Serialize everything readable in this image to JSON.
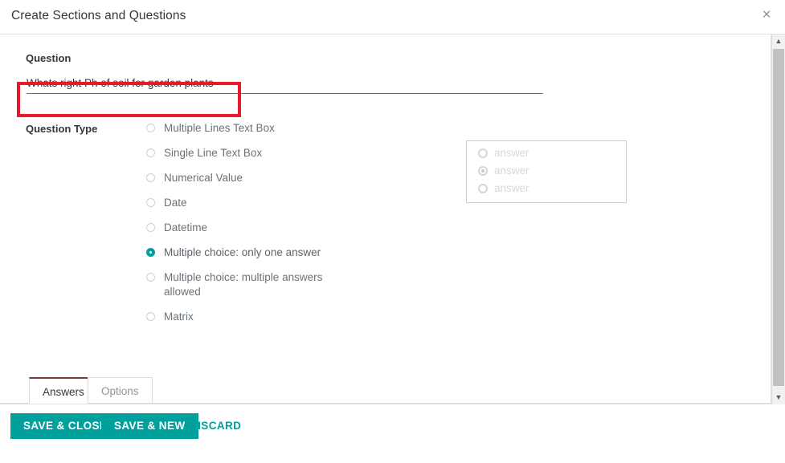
{
  "header": {
    "title": "Create Sections and Questions",
    "close_label": "×"
  },
  "form": {
    "question": {
      "label": "Question",
      "value": "Whats right Ph of soil for garden plants",
      "placeholder": ""
    },
    "question_type": {
      "label": "Question Type",
      "selected": "Multiple choice: only one answer",
      "options": [
        {
          "label": "Multiple Lines Text Box",
          "checked": false
        },
        {
          "label": "Single Line Text Box",
          "checked": false
        },
        {
          "label": "Numerical Value",
          "checked": false
        },
        {
          "label": "Date",
          "checked": false
        },
        {
          "label": "Datetime",
          "checked": false
        },
        {
          "label": "Multiple choice: only one answer",
          "checked": true
        },
        {
          "label": "Multiple choice: multiple answers allowed",
          "checked": false
        },
        {
          "label": "Matrix",
          "checked": false
        }
      ]
    },
    "preview": {
      "rows": [
        {
          "label": "answer",
          "checked": false
        },
        {
          "label": "answer",
          "checked": true
        },
        {
          "label": "answer",
          "checked": false
        }
      ]
    }
  },
  "tabs": [
    {
      "label": "Answers",
      "active": true
    },
    {
      "label": "Options",
      "active": false
    }
  ],
  "footer": {
    "save_close_label": "SAVE & CLOSE",
    "save_new_label": "SAVE & NEW",
    "discard_label": "DISCARD"
  },
  "scrollbar": {
    "up_arrow": "▲",
    "down_arrow": "▼"
  },
  "colors": {
    "accent": "#00a09d",
    "highlight": "#e8192c",
    "active_tab_border": "#7b3b3b"
  }
}
